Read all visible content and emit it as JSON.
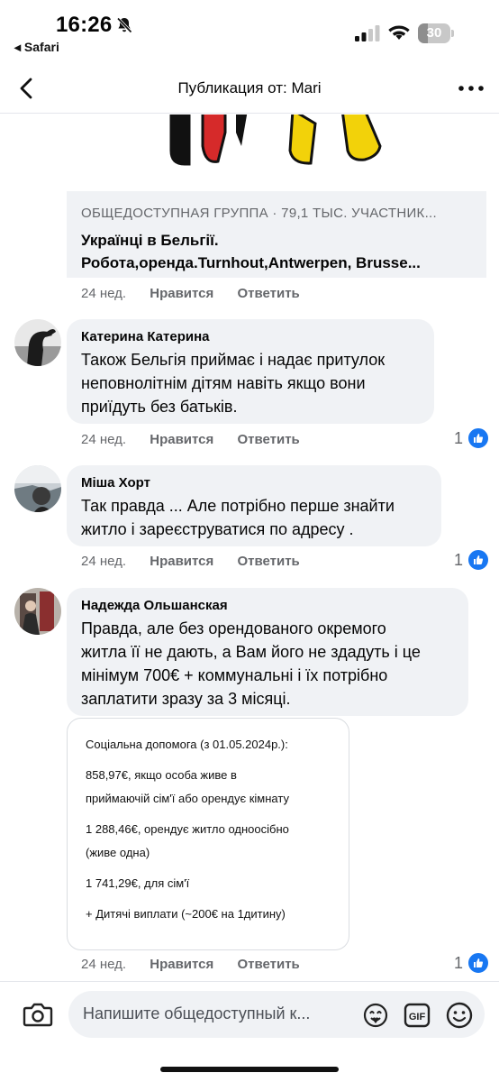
{
  "status_bar": {
    "time": "16:26",
    "back_app": "◂ Safari",
    "battery": "30",
    "battery_level_percent": 30
  },
  "header": {
    "title": "Публикация от: Mari"
  },
  "link_preview": {
    "meta": "ОБЩЕДОСТУПНАЯ ГРУППА · 79,1 ТЫС. УЧАСТНИК...",
    "title_line1": "Українці в Бельгії.",
    "title_line2": "Робота,оренда.Turnhout,Antwerpen, Brusse..."
  },
  "labels": {
    "like": "Нравится",
    "reply": "Ответить"
  },
  "post_actions": {
    "time": "24 нед."
  },
  "comments": [
    {
      "author": "Катерина Катерина",
      "lines": [
        "Також Бельгія приймає і надає притулок",
        "неповнолітнім дітям навіть якщо вони",
        "приїдуть без батьків."
      ],
      "time": "24 нед.",
      "reactions": "1"
    },
    {
      "author": "Міша Хорт",
      "lines": [
        "Так правда ... Але потрібно перше знайти",
        "житло і зареєструватися по адресу ."
      ],
      "time": "24 нед.",
      "reactions": "1"
    },
    {
      "author": "Надежда Ольшанская",
      "lines": [
        "Правда, але без орендованого окремого",
        "житла її не дають, а Вам його не здадуть і це",
        "мінімум 700€ + коммунальні і їх потрібно",
        "заплатити зразу за 3 місяці."
      ],
      "time": "24 нед.",
      "reactions": "1"
    }
  ],
  "info_card": {
    "line1": "Соціальна допомога (з 01.05.2024р.):",
    "line2": "858,97€, якщо особа живе в",
    "line3": "приймаючій сім'ї або орендує кімнату",
    "line4": "1 288,46€, орендує житло одноосібно",
    "line5": "(живе одна)",
    "line6": "1 741,29€, для сім'ї",
    "line7": "+ Дитячі виплати (~200€ на 1дитину)"
  },
  "composer": {
    "placeholder": "Напишите общедоступный к..."
  },
  "colors": {
    "accent": "#1877f2",
    "bubble": "#f0f2f5",
    "secondary_text": "#65676b"
  },
  "icons": [
    "bell-slash-icon",
    "signal-icon",
    "wifi-icon",
    "battery-icon",
    "chevron-left-icon",
    "more-icon",
    "like-icon",
    "camera-icon",
    "avatar-sticker-icon",
    "gif-icon",
    "emoji-icon"
  ]
}
